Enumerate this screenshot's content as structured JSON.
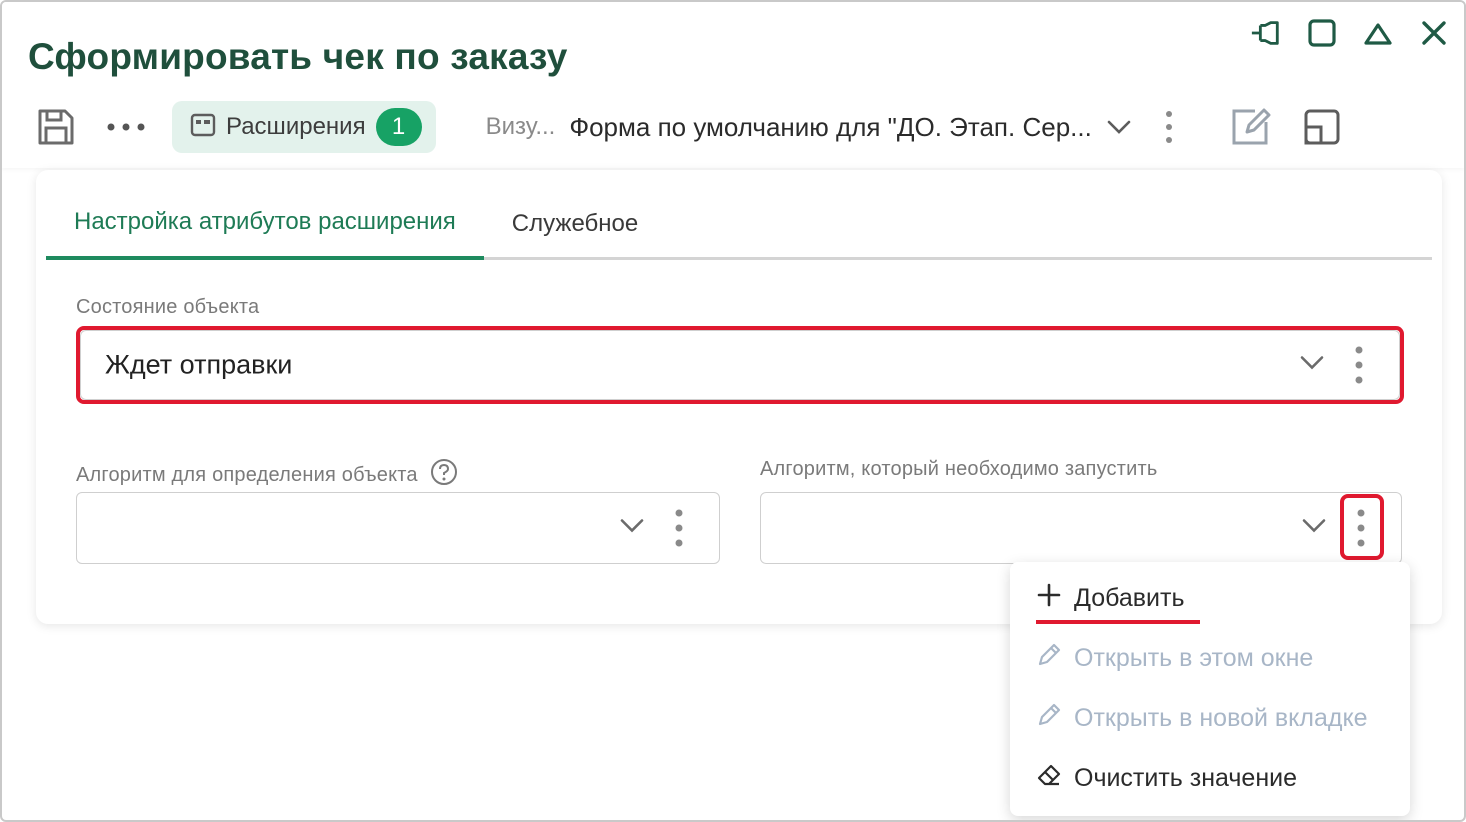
{
  "window": {
    "title": "Сформировать чек по заказу",
    "controls": [
      "pin-icon",
      "maximize-icon",
      "collapse-icon",
      "close-icon"
    ]
  },
  "toolbar": {
    "save_icon": "save-icon",
    "more_icon": "more-horizontal-icon",
    "extensions_label": "Расширения",
    "extensions_count": "1",
    "view_label": "Визу...",
    "view_value": "Форма по умолчанию для \"ДО. Этап. Сер...",
    "edit_icon": "edit-form-icon",
    "layout_icon": "layout-icon"
  },
  "tabs": [
    {
      "label": "Настройка атрибутов расширения",
      "active": true
    },
    {
      "label": "Служебное",
      "active": false
    }
  ],
  "fields": {
    "state": {
      "label": "Состояние объекта",
      "value": "Ждет отправки"
    },
    "algorithm_define": {
      "label": "Алгоритм для определения объекта",
      "value": ""
    },
    "algorithm_run": {
      "label": "Алгоритм, который необходимо запустить",
      "value": ""
    }
  },
  "menu": {
    "items": [
      {
        "label": "Добавить",
        "icon": "plus-icon",
        "enabled": true
      },
      {
        "label": "Открыть в этом окне",
        "icon": "pencil-icon",
        "enabled": false
      },
      {
        "label": "Открыть в новой вкладке",
        "icon": "pencil-icon",
        "enabled": false
      },
      {
        "label": "Очистить значение",
        "icon": "eraser-icon",
        "enabled": true
      }
    ]
  },
  "colors": {
    "accent": "#1e8a5e",
    "title": "#1f4f3c",
    "badge": "#17a265",
    "highlight": "#e0192f",
    "disabled": "#a8b6c7"
  }
}
